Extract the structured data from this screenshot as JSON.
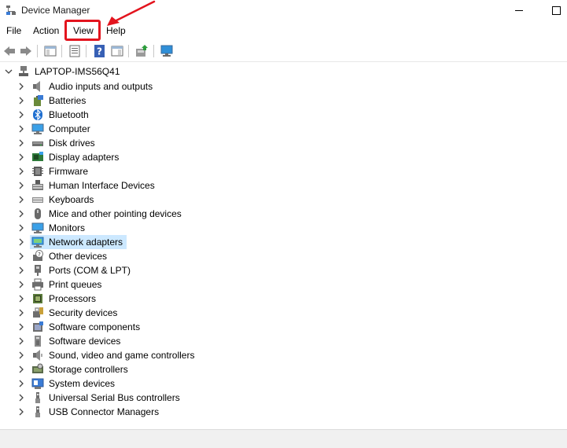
{
  "window": {
    "title": "Device Manager"
  },
  "menu": [
    "File",
    "Action",
    "View",
    "Help"
  ],
  "toolbar": [
    {
      "name": "back-button",
      "icon": "arrow-left-icon"
    },
    {
      "name": "forward-button",
      "icon": "arrow-right-icon"
    },
    {
      "name": "show-hide-console-tree-button",
      "icon": "console-tree-icon"
    },
    {
      "name": "properties-button",
      "icon": "properties-icon"
    },
    {
      "name": "help-button",
      "icon": "help-icon"
    },
    {
      "name": "show-action-pane-button",
      "icon": "action-pane-icon"
    },
    {
      "name": "update-driver-button",
      "icon": "update-driver-icon"
    },
    {
      "name": "scan-hardware-button",
      "icon": "monitor-scan-icon"
    }
  ],
  "tree": {
    "root": "LAPTOP-IMS56Q41",
    "categories": [
      {
        "label": "Audio inputs and outputs",
        "icon": "speaker-icon"
      },
      {
        "label": "Batteries",
        "icon": "battery-icon"
      },
      {
        "label": "Bluetooth",
        "icon": "bluetooth-icon"
      },
      {
        "label": "Computer",
        "icon": "computer-icon"
      },
      {
        "label": "Disk drives",
        "icon": "disk-drive-icon"
      },
      {
        "label": "Display adapters",
        "icon": "display-adapter-icon"
      },
      {
        "label": "Firmware",
        "icon": "firmware-icon"
      },
      {
        "label": "Human Interface Devices",
        "icon": "hid-icon"
      },
      {
        "label": "Keyboards",
        "icon": "keyboard-icon"
      },
      {
        "label": "Mice and other pointing devices",
        "icon": "mouse-icon"
      },
      {
        "label": "Monitors",
        "icon": "monitor-icon"
      },
      {
        "label": "Network adapters",
        "icon": "network-adapter-icon",
        "selected": true
      },
      {
        "label": "Other devices",
        "icon": "other-devices-icon"
      },
      {
        "label": "Ports (COM & LPT)",
        "icon": "port-icon"
      },
      {
        "label": "Print queues",
        "icon": "printer-icon"
      },
      {
        "label": "Processors",
        "icon": "processor-icon"
      },
      {
        "label": "Security devices",
        "icon": "security-device-icon"
      },
      {
        "label": "Software components",
        "icon": "software-component-icon"
      },
      {
        "label": "Software devices",
        "icon": "software-device-icon"
      },
      {
        "label": "Sound, video and game controllers",
        "icon": "sound-controller-icon"
      },
      {
        "label": "Storage controllers",
        "icon": "storage-controller-icon"
      },
      {
        "label": "System devices",
        "icon": "system-device-icon"
      },
      {
        "label": "Universal Serial Bus controllers",
        "icon": "usb-icon"
      },
      {
        "label": "USB Connector Managers",
        "icon": "usb-connector-icon"
      }
    ]
  },
  "colors": {
    "highlight": "#e3141e",
    "selection": "#cce8ff"
  }
}
